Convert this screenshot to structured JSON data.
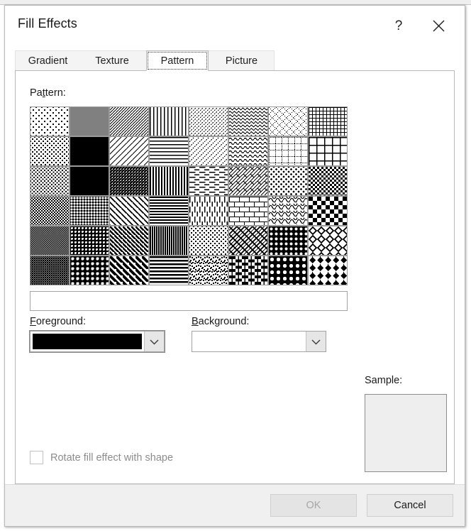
{
  "window": {
    "title": "Fill Effects",
    "help_icon": "question-mark-icon",
    "close_icon": "close-icon"
  },
  "tabs": [
    {
      "id": "gradient",
      "label": "Gradient",
      "active": false
    },
    {
      "id": "texture",
      "label": "Texture",
      "active": false
    },
    {
      "id": "pattern",
      "label": "Pattern",
      "active": true
    },
    {
      "id": "picture",
      "label": "Picture",
      "active": false
    }
  ],
  "panel": {
    "pattern_label": "Pattern:",
    "pattern_label_accel": "t",
    "foreground_label": "Foreground:",
    "foreground_label_accel": "F",
    "background_label": "Background:",
    "background_label_accel": "B",
    "sample_label": "Sample:",
    "name_box_value": "",
    "foreground_color": "#000000",
    "background_color": "#ffffff",
    "sample_color": "#eeeeee",
    "rotate_checkbox": {
      "label": "Rotate fill effect with shape",
      "checked": false,
      "enabled": false
    }
  },
  "patterns": {
    "columns": 8,
    "rows": 6,
    "selected_index": null,
    "cells": [
      {
        "name": "5%",
        "kind": "dots",
        "density": 0.05,
        "scale": 8
      },
      {
        "name": "50%",
        "kind": "dots",
        "density": 0.5,
        "scale": 2
      },
      {
        "name": "Light upward diagonal",
        "kind": "diag",
        "dir": "up",
        "spacing": 4,
        "weight": 1
      },
      {
        "name": "Light vertical",
        "kind": "vert",
        "spacing": 5,
        "weight": 1.4
      },
      {
        "name": "Narrow horizontal",
        "kind": "dashdiag",
        "dir": "up",
        "spacing": 5
      },
      {
        "name": "Zig zag",
        "kind": "wave",
        "spacing": 6,
        "amp": 2.4
      },
      {
        "name": "Dotted diamond",
        "kind": "dotdiamond",
        "spacing": 10
      },
      {
        "name": "Small grid",
        "kind": "grid",
        "spacing": 5,
        "weight": 1.2
      },
      {
        "name": "10%",
        "kind": "dots",
        "density": 0.1,
        "scale": 6
      },
      {
        "name": "60%",
        "kind": "dots",
        "density": 0.6,
        "scale": 2
      },
      {
        "name": "Wide upward diagonal",
        "kind": "diag",
        "dir": "up",
        "spacing": 8,
        "weight": 1.3
      },
      {
        "name": "Light horizontal",
        "kind": "horz",
        "spacing": 5,
        "weight": 1.6
      },
      {
        "name": "Narrow vertical",
        "kind": "dashdiag",
        "dir": "up",
        "spacing": 7
      },
      {
        "name": "Wave",
        "kind": "wave",
        "spacing": 7,
        "amp": 3
      },
      {
        "name": "Dotted grid",
        "kind": "dotgrid",
        "spacing": 9
      },
      {
        "name": "Large grid",
        "kind": "grid",
        "spacing": 11,
        "weight": 1.6
      },
      {
        "name": "20%",
        "kind": "dots",
        "density": 0.2,
        "scale": 5
      },
      {
        "name": "70%",
        "kind": "dots",
        "density": 0.7,
        "scale": 2
      },
      {
        "name": "Dark upward diagonal",
        "kind": "diag",
        "dir": "up",
        "spacing": 4,
        "weight": 2.2
      },
      {
        "name": "Dark vertical",
        "kind": "vert",
        "spacing": 4,
        "weight": 2.2
      },
      {
        "name": "Dashed horizontal",
        "kind": "dashhorz",
        "spacing": 7
      },
      {
        "name": "Diagonal brick",
        "kind": "diagbrick",
        "spacing": 10
      },
      {
        "name": "Dotted sparse",
        "kind": "dots",
        "density": 0.12,
        "scale": 7
      },
      {
        "name": "Small checker board",
        "kind": "checker",
        "size": 3
      },
      {
        "name": "25%",
        "kind": "dots",
        "density": 0.25,
        "scale": 4
      },
      {
        "name": "80%",
        "kind": "dots",
        "density": 0.8,
        "scale": 4
      },
      {
        "name": "Wide downward diagonal",
        "kind": "diag",
        "dir": "down",
        "spacing": 8,
        "weight": 2
      },
      {
        "name": "Dark horizontal",
        "kind": "horz",
        "spacing": 4,
        "weight": 2.2
      },
      {
        "name": "Dashed vertical",
        "kind": "dashvert",
        "spacing": 7
      },
      {
        "name": "Horizontal brick",
        "kind": "brick",
        "w": 14,
        "h": 7
      },
      {
        "name": "Weave",
        "kind": "weave",
        "spacing": 10
      },
      {
        "name": "Large checker board",
        "kind": "checker",
        "size": 6
      },
      {
        "name": "30%",
        "kind": "dots",
        "density": 0.3,
        "scale": 3
      },
      {
        "name": "90%",
        "kind": "dots",
        "density": 0.9,
        "scale": 5
      },
      {
        "name": "Light downward diagonal",
        "kind": "diag",
        "dir": "down",
        "spacing": 6,
        "weight": 2.4
      },
      {
        "name": "Narrow vertical dense",
        "kind": "vert",
        "spacing": 3,
        "weight": 2
      },
      {
        "name": "Trellis",
        "kind": "dots",
        "density": 0.14,
        "scale": 6
      },
      {
        "name": "Plaid",
        "kind": "plaid",
        "spacing": 11
      },
      {
        "name": "Sphere",
        "kind": "sphere",
        "spacing": 7
      },
      {
        "name": "Large confetti",
        "kind": "diamondgrid",
        "spacing": 12
      },
      {
        "name": "40%",
        "kind": "dots",
        "density": 0.4,
        "scale": 3
      },
      {
        "name": "Solid diamond dots",
        "kind": "dots",
        "density": 0.88,
        "scale": 7
      },
      {
        "name": "Wide downward diagonal 2",
        "kind": "diag",
        "dir": "down",
        "spacing": 9,
        "weight": 4
      },
      {
        "name": "Dark horizontal 2",
        "kind": "horz",
        "spacing": 5,
        "weight": 2.6
      },
      {
        "name": "Small confetti",
        "kind": "confetti",
        "scale": 3
      },
      {
        "name": "Shingle",
        "kind": "shingle",
        "spacing": 9
      },
      {
        "name": "Outlined diamond",
        "kind": "sphere",
        "spacing": 9
      },
      {
        "name": "Diamond",
        "kind": "diamonds",
        "spacing": 11
      }
    ]
  },
  "buttons": {
    "ok": {
      "label": "OK",
      "enabled": false
    },
    "cancel": {
      "label": "Cancel",
      "enabled": true
    }
  }
}
